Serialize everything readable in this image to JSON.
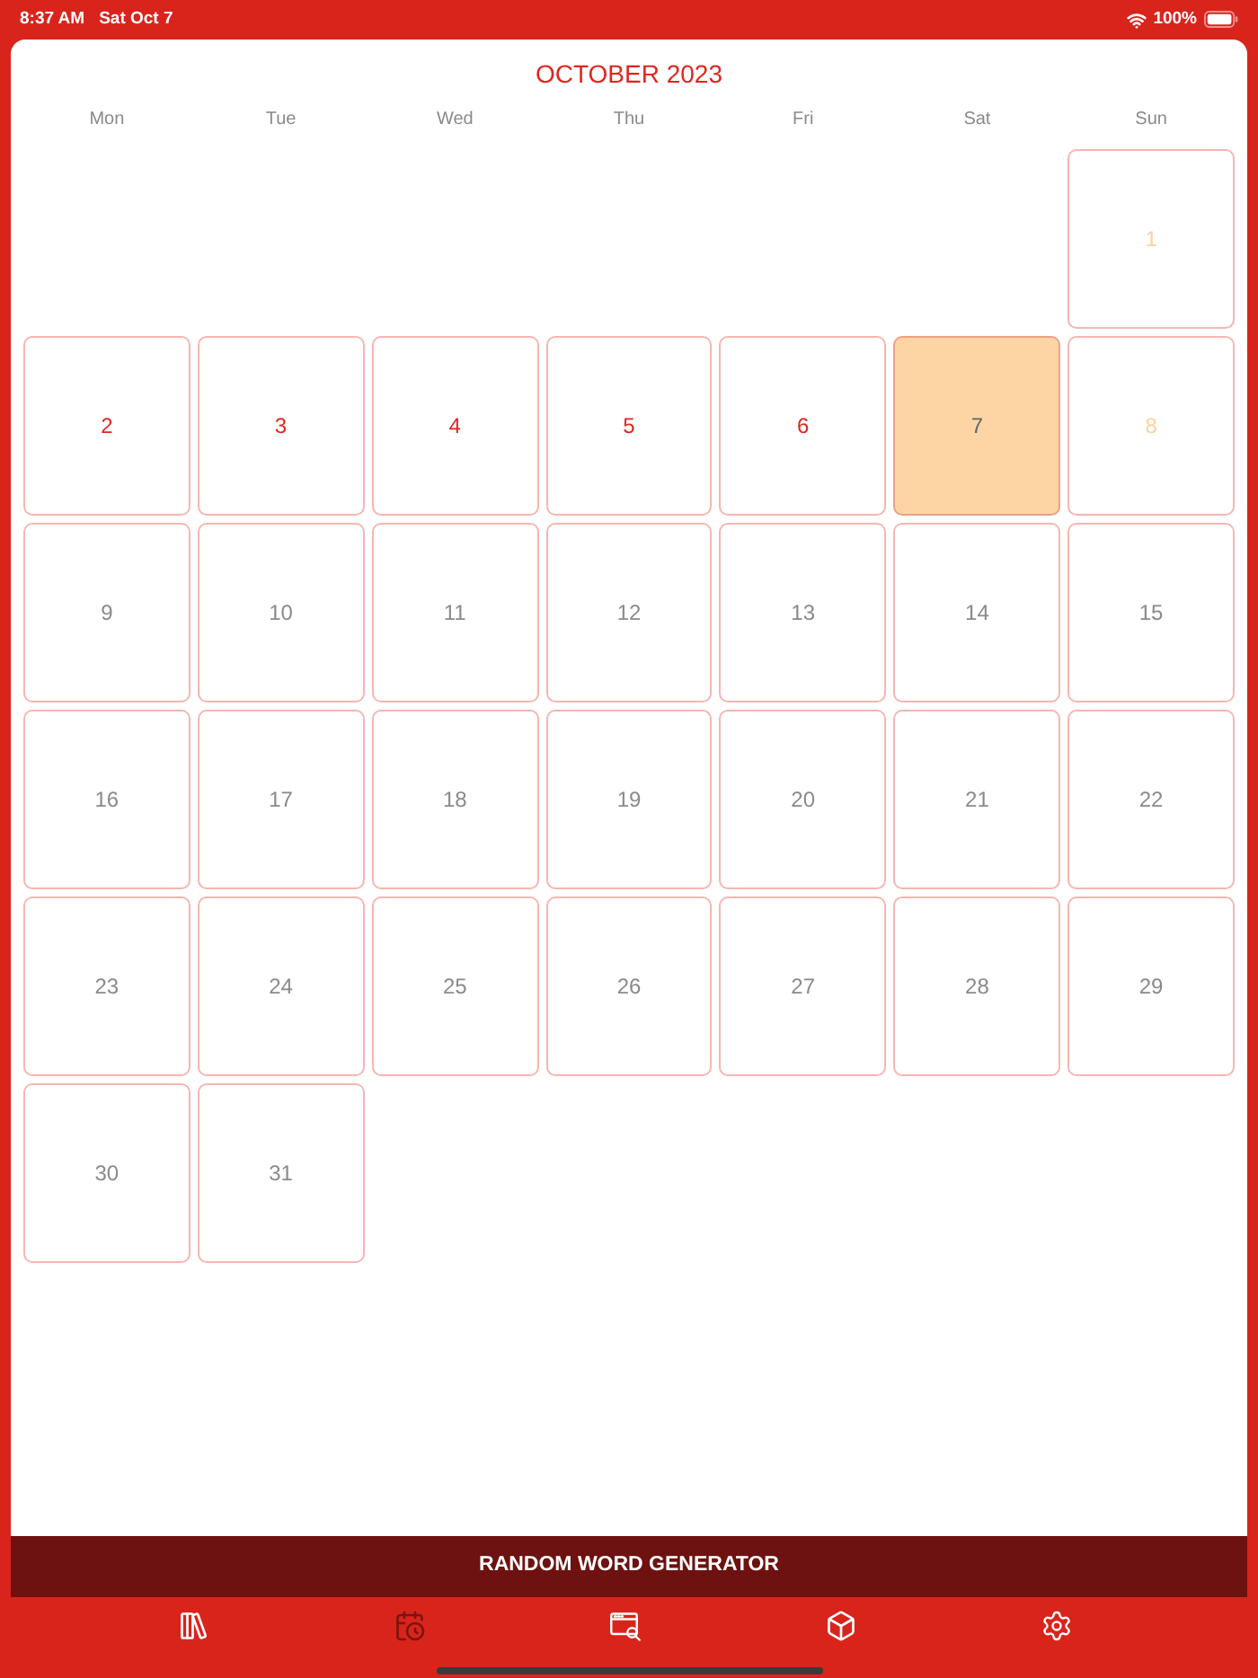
{
  "status_bar": {
    "time": "8:37 AM",
    "date": "Sat Oct 7",
    "battery": "100%"
  },
  "calendar": {
    "title": "OCTOBER 2023",
    "weekdays": [
      "Mon",
      "Tue",
      "Wed",
      "Thu",
      "Fri",
      "Sat",
      "Sun"
    ],
    "weeks": [
      [
        {
          "label": "1",
          "kind": "weekend",
          "selected": false
        }
      ],
      [
        {
          "label": "2",
          "kind": "past",
          "selected": false
        },
        {
          "label": "3",
          "kind": "past",
          "selected": false
        },
        {
          "label": "4",
          "kind": "past",
          "selected": false
        },
        {
          "label": "5",
          "kind": "past",
          "selected": false
        },
        {
          "label": "6",
          "kind": "past",
          "selected": false
        },
        {
          "label": "7",
          "kind": "today",
          "selected": true
        },
        {
          "label": "8",
          "kind": "weekend",
          "selected": false
        }
      ],
      [
        {
          "label": "9",
          "kind": "upcoming",
          "selected": false
        },
        {
          "label": "10",
          "kind": "upcoming",
          "selected": false
        },
        {
          "label": "11",
          "kind": "upcoming",
          "selected": false
        },
        {
          "label": "12",
          "kind": "upcoming",
          "selected": false
        },
        {
          "label": "13",
          "kind": "upcoming",
          "selected": false
        },
        {
          "label": "14",
          "kind": "upcoming",
          "selected": false
        },
        {
          "label": "15",
          "kind": "upcoming",
          "selected": false
        }
      ],
      [
        {
          "label": "16",
          "kind": "upcoming",
          "selected": false
        },
        {
          "label": "17",
          "kind": "upcoming",
          "selected": false
        },
        {
          "label": "18",
          "kind": "upcoming",
          "selected": false
        },
        {
          "label": "19",
          "kind": "upcoming",
          "selected": false
        },
        {
          "label": "20",
          "kind": "upcoming",
          "selected": false
        },
        {
          "label": "21",
          "kind": "upcoming",
          "selected": false
        },
        {
          "label": "22",
          "kind": "upcoming",
          "selected": false
        }
      ],
      [
        {
          "label": "23",
          "kind": "upcoming",
          "selected": false
        },
        {
          "label": "24",
          "kind": "upcoming",
          "selected": false
        },
        {
          "label": "25",
          "kind": "upcoming",
          "selected": false
        },
        {
          "label": "26",
          "kind": "upcoming",
          "selected": false
        },
        {
          "label": "27",
          "kind": "upcoming",
          "selected": false
        },
        {
          "label": "28",
          "kind": "upcoming",
          "selected": false
        },
        {
          "label": "29",
          "kind": "upcoming",
          "selected": false
        }
      ],
      [
        {
          "label": "30",
          "kind": "upcoming",
          "selected": false
        },
        {
          "label": "31",
          "kind": "upcoming",
          "selected": false
        }
      ]
    ]
  },
  "banner": {
    "label": "RANDOM WORD GENERATOR"
  },
  "tab_bar": [
    {
      "kind": "library",
      "selected": false
    },
    {
      "kind": "calendar",
      "selected": true
    },
    {
      "kind": "browser-search",
      "selected": false
    },
    {
      "kind": "cube",
      "selected": false
    },
    {
      "kind": "settings",
      "selected": false
    }
  ]
}
